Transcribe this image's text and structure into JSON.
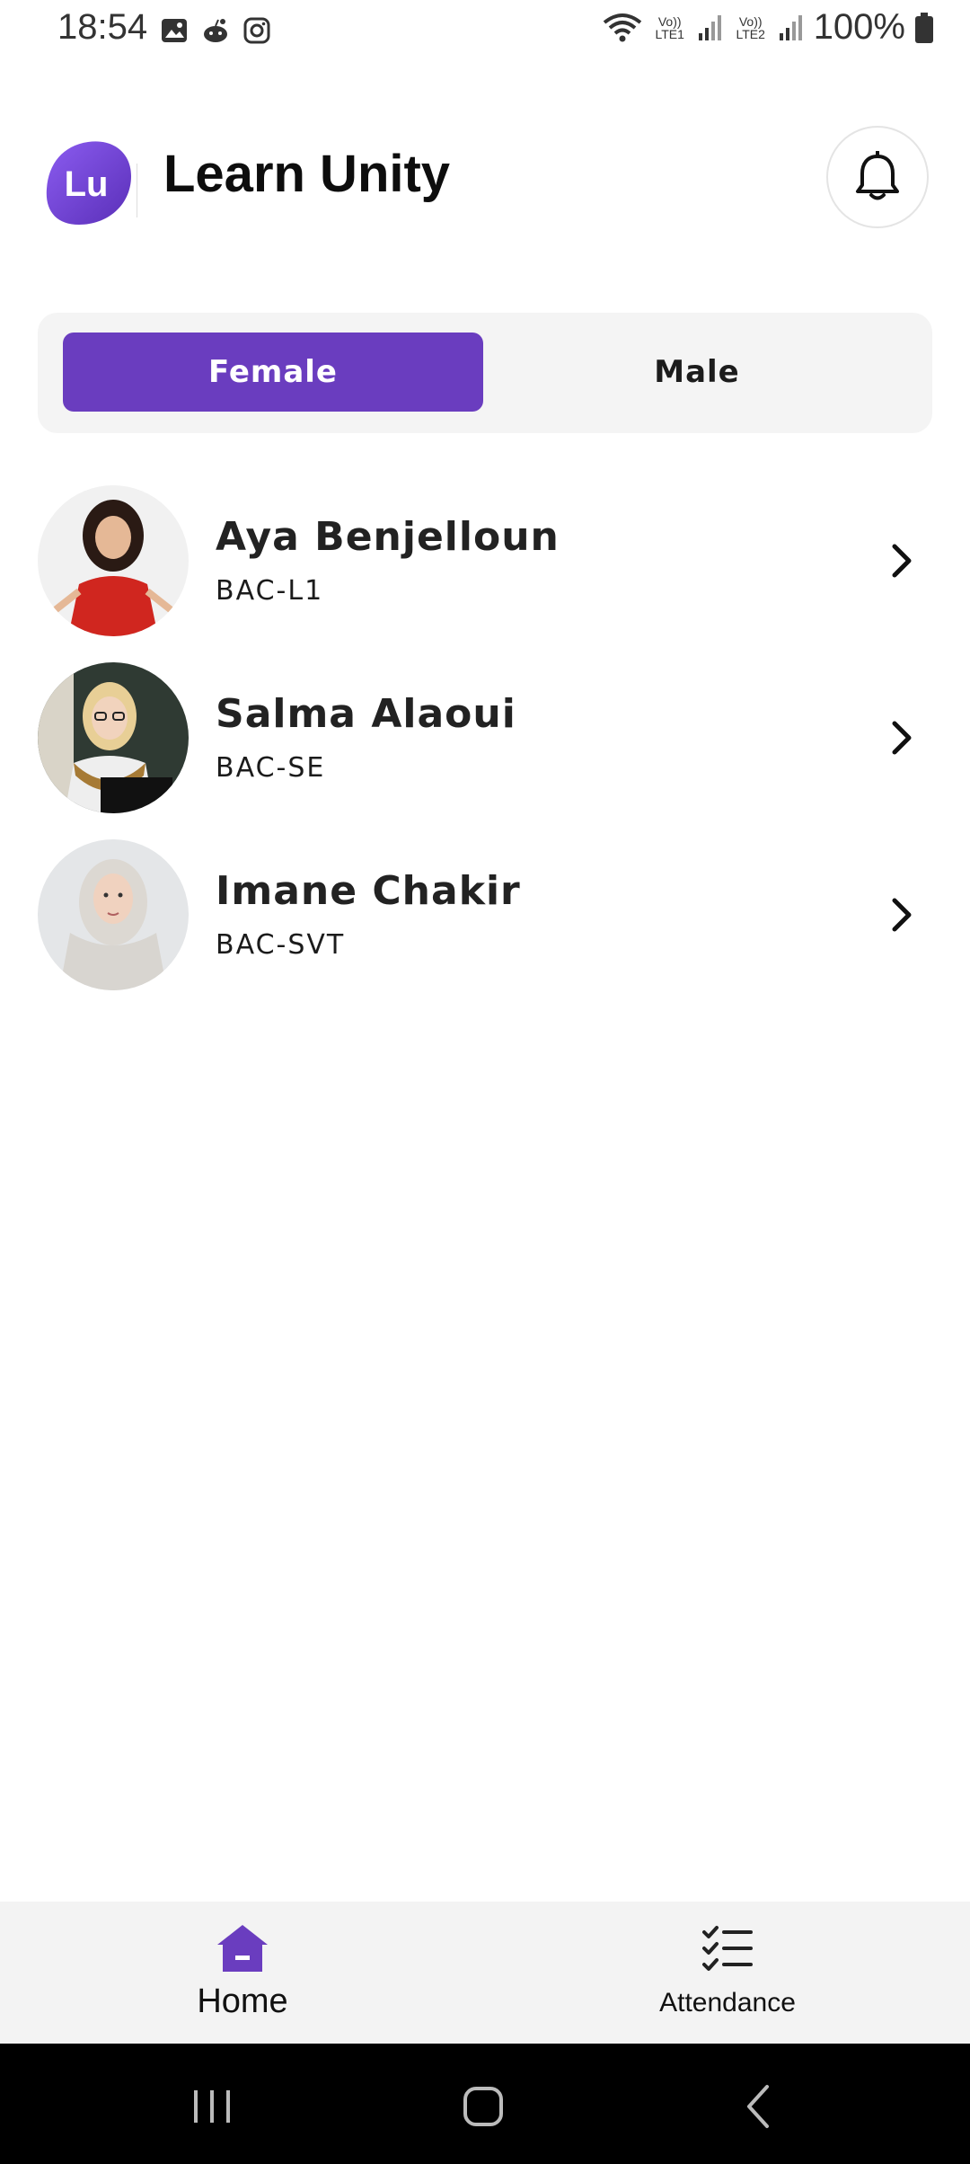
{
  "status_bar": {
    "time": "18:54",
    "battery": "100%",
    "net1": "Vo)) LTE1",
    "net2": "Vo)) LTE2"
  },
  "header": {
    "logo_text": "Lu",
    "title": "Learn Unity"
  },
  "tabs": {
    "female": "Female",
    "male": "Male",
    "selected": "Female"
  },
  "students": [
    {
      "name": "Aya Benjelloun",
      "track": "BAC-L1"
    },
    {
      "name": "Salma Alaoui",
      "track": "BAC-SE"
    },
    {
      "name": "Imane Chakir",
      "track": "BAC-SVT"
    }
  ],
  "bottom_nav": {
    "home": "Home",
    "attendance": "Attendance",
    "active": "Home"
  },
  "colors": {
    "accent": "#6a3dbf",
    "text": "#222222",
    "segment_bg": "#f4f4f4"
  }
}
